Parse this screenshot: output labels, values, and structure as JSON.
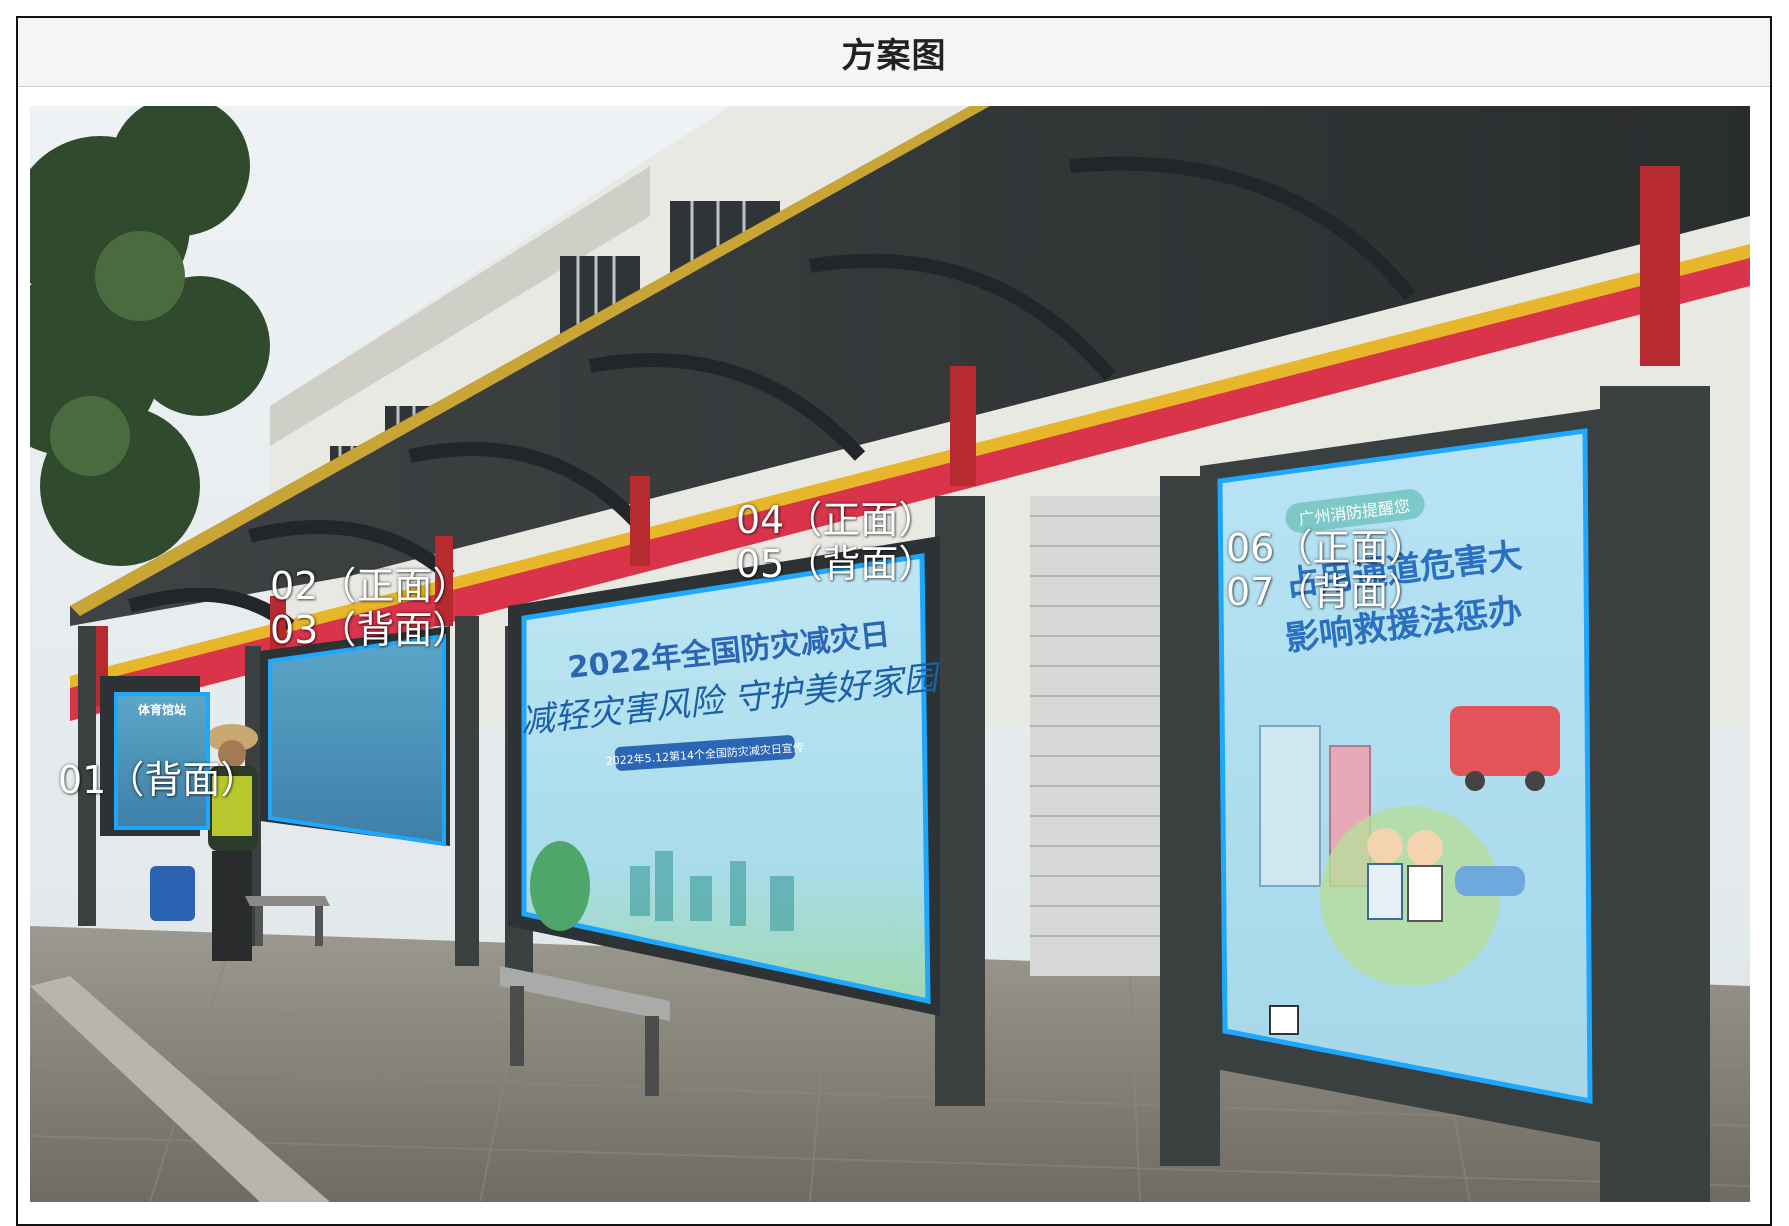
{
  "header": {
    "title": "方案图"
  },
  "photo": {
    "description_icon": "bus-shelter-photo",
    "labels": {
      "l01": "01（背面）",
      "l02": "02（正面）",
      "l03": "03（背面）",
      "l04": "04（正面）",
      "l05": "05（背面）",
      "l06": "06（正面）",
      "l07": "07（背面）"
    },
    "posters": {
      "small_sign": "体育馆站",
      "poster_mid_title": "2022年全国防灾减灾日",
      "poster_mid_slogan": "减轻灾害风险 守护美好家园",
      "poster_mid_sub": "2022年5.12第14个全国防灾减灾日宣传",
      "poster_right_badge": "广州消防提醒您",
      "poster_right_title": "占用通道危害大",
      "poster_right_title2": "影响救援法惩办"
    },
    "colors": {
      "highlight": "#1ea7ff",
      "shelter_frame": "#3b4040",
      "roof_trim_red": "#d9344a",
      "roof_trim_yellow": "#e8b62a"
    }
  }
}
